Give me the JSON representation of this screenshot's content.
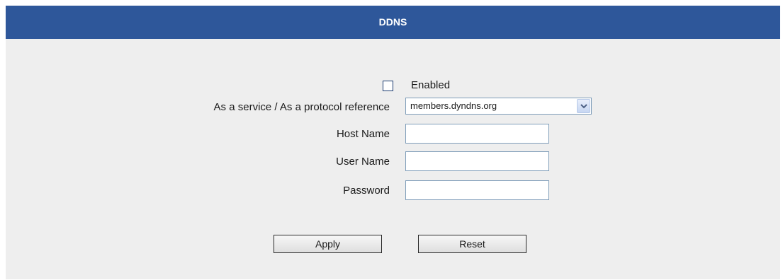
{
  "header": {
    "title": "DDNS"
  },
  "form": {
    "enabled": {
      "label": "Enabled",
      "checked": false
    },
    "service": {
      "label": "As a service / As a protocol reference",
      "value": "members.dyndns.org"
    },
    "host_name": {
      "label": "Host Name",
      "value": ""
    },
    "user_name": {
      "label": "User Name",
      "value": ""
    },
    "password": {
      "label": "Password",
      "value": ""
    }
  },
  "buttons": {
    "apply": "Apply",
    "reset": "Reset"
  }
}
